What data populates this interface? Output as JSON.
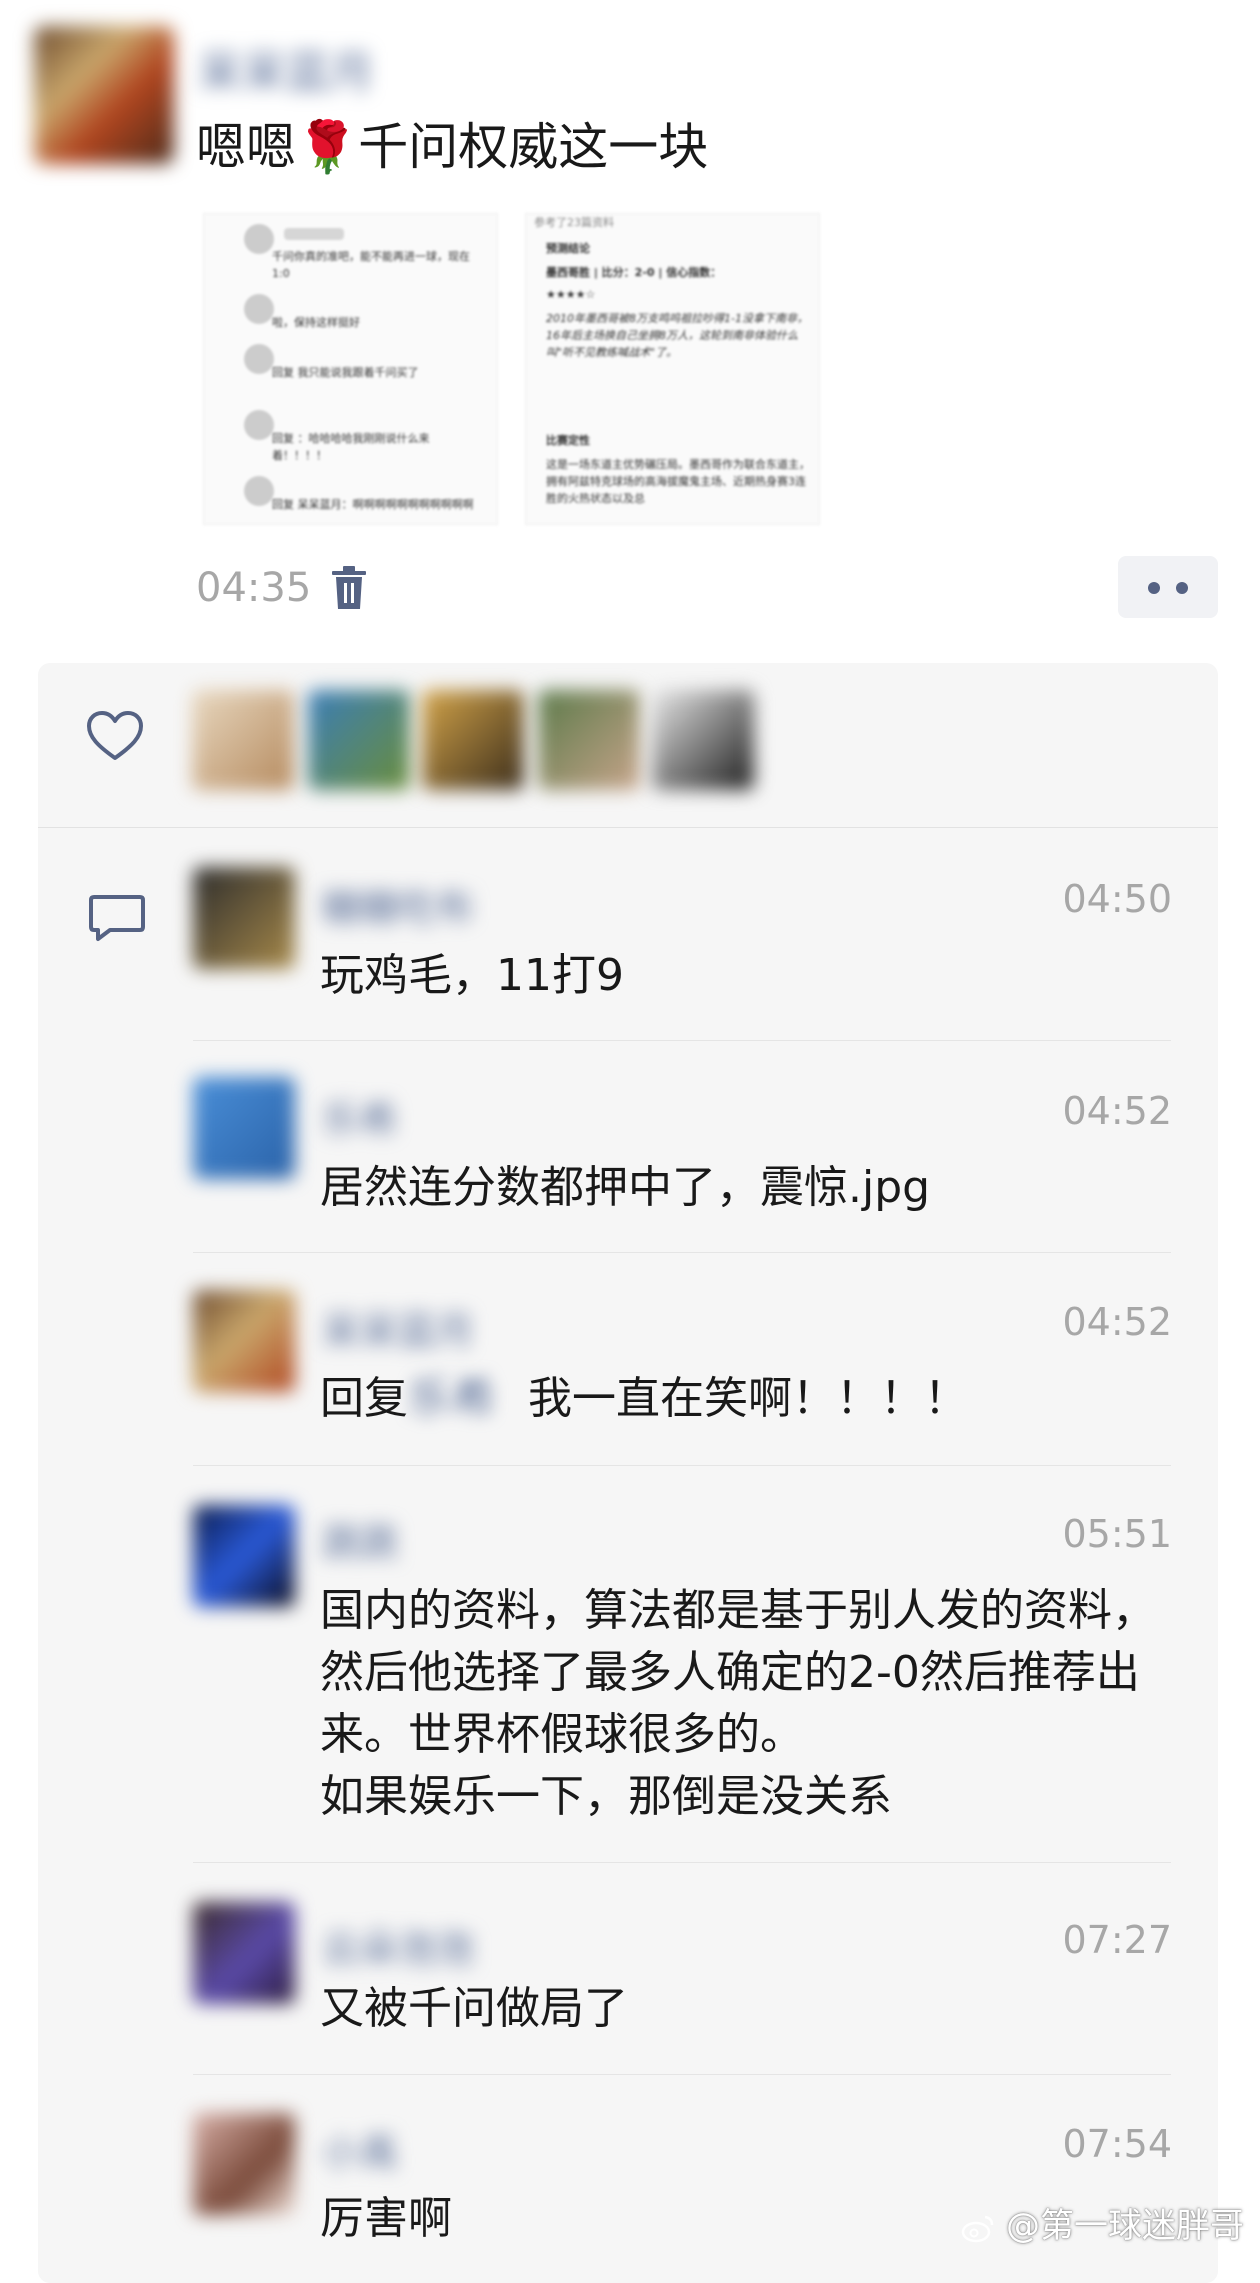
{
  "post": {
    "author": "呆呆蓝月",
    "text": "嗯嗯🌹千问权威这一块",
    "time": "04:35",
    "thumb1_lines": [
      "千问你真的准吧，能不能再进一球，现在1:0",
      "啦，保持这样挺好",
      "回复 我只能说我跟着千问买了",
      "回复 ：哈哈哈哈我刚刚说什么来着！！！！",
      "回复 呆呆蓝月：啊啊啊啊啊啊啊啊啊啊啊"
    ],
    "thumb2_lines": [
      "参考了23篇资料",
      "预测结论",
      "墨西哥胜 | 比分：2-0 | 信心指数：",
      "★★★★☆",
      "2010年墨西哥被8万支鸣呜祖拉吵得1-1没拿下南非，16年后主场换自己坐拥8万人，这轮到南非体验什么叫\"听不见教练喊战术\"了。",
      "比赛定性",
      "这是一场东道主优势碾压局。墨西哥作为联合东道主，拥有阿兹特克球场的高海拔魔鬼主场、近期热身赛3连胜的火热状态以及总"
    ]
  },
  "comments": [
    {
      "name": "糖糖吃布",
      "time": "04:50",
      "text": "玩鸡毛，11打9"
    },
    {
      "name": "乐希",
      "time": "04:52",
      "text": "居然连分数都押中了，震惊.jpg"
    },
    {
      "name": "呆呆蓝月",
      "time": "04:52",
      "reply_prefix": "回复",
      "reply_to": "乐希",
      "text": "我一直在笑啊！！！！"
    },
    {
      "name": "蔬蔬",
      "time": "05:51",
      "text": "国内的资料，算法都是基于别人发的资料，然后他选择了最多人确定的2-0然后推荐出来。世界杯假球很多的。\n如果娱乐一下，那倒是没关系"
    },
    {
      "name": "云朵泡泡",
      "time": "07:27",
      "text": "又被千问做局了"
    },
    {
      "name": "小禹",
      "time": "07:54",
      "text": "厉害啊"
    }
  ],
  "watermark": "@第一球迷胖哥",
  "colors": {
    "name_link": "#5a6f99",
    "time_gray": "#a7a7a7",
    "panel_bg": "#f6f6f6",
    "icon_blue": "#556283"
  },
  "icons": [
    "trash-icon",
    "more-icon",
    "like-heart-icon",
    "comment-icon",
    "weibo-logo-icon"
  ]
}
